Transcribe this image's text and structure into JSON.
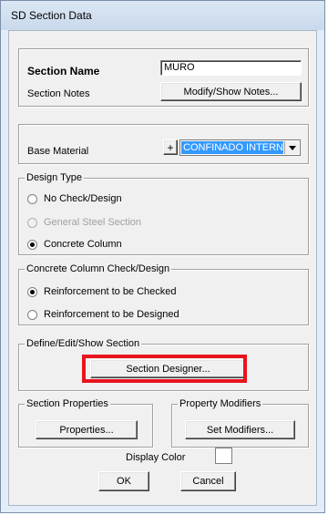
{
  "window": {
    "title": "SD Section Data"
  },
  "section": {
    "name_label": "Section Name",
    "name_value": "MURO",
    "notes_label": "Section Notes",
    "notes_button": "Modify/Show Notes..."
  },
  "material": {
    "label": "Base Material",
    "plus_button": "+",
    "selected": "CONFINADO INTERNO",
    "dropdown_arrow": "chevron-down-icon"
  },
  "design_type": {
    "legend": "Design Type",
    "options": [
      {
        "label": "No Check/Design",
        "checked": false,
        "disabled": false
      },
      {
        "label": "General Steel Section",
        "checked": false,
        "disabled": true
      },
      {
        "label": "Concrete Column",
        "checked": true,
        "disabled": false
      }
    ]
  },
  "concrete_check": {
    "legend": "Concrete Column Check/Design",
    "options": [
      {
        "label": "Reinforcement to be Checked",
        "checked": true
      },
      {
        "label": "Reinforcement to be Designed",
        "checked": false
      }
    ]
  },
  "define_section": {
    "legend": "Define/Edit/Show Section",
    "button": "Section Designer..."
  },
  "section_properties": {
    "legend": "Section Properties",
    "button": "Properties..."
  },
  "property_modifiers": {
    "legend": "Property Modifiers",
    "button": "Set Modifiers..."
  },
  "display": {
    "color_label": "Display Color",
    "color_value": "#ffffff"
  },
  "footer": {
    "ok": "OK",
    "cancel": "Cancel"
  },
  "colors": {
    "highlight": "#e8141c",
    "selection": "#3399ff"
  }
}
